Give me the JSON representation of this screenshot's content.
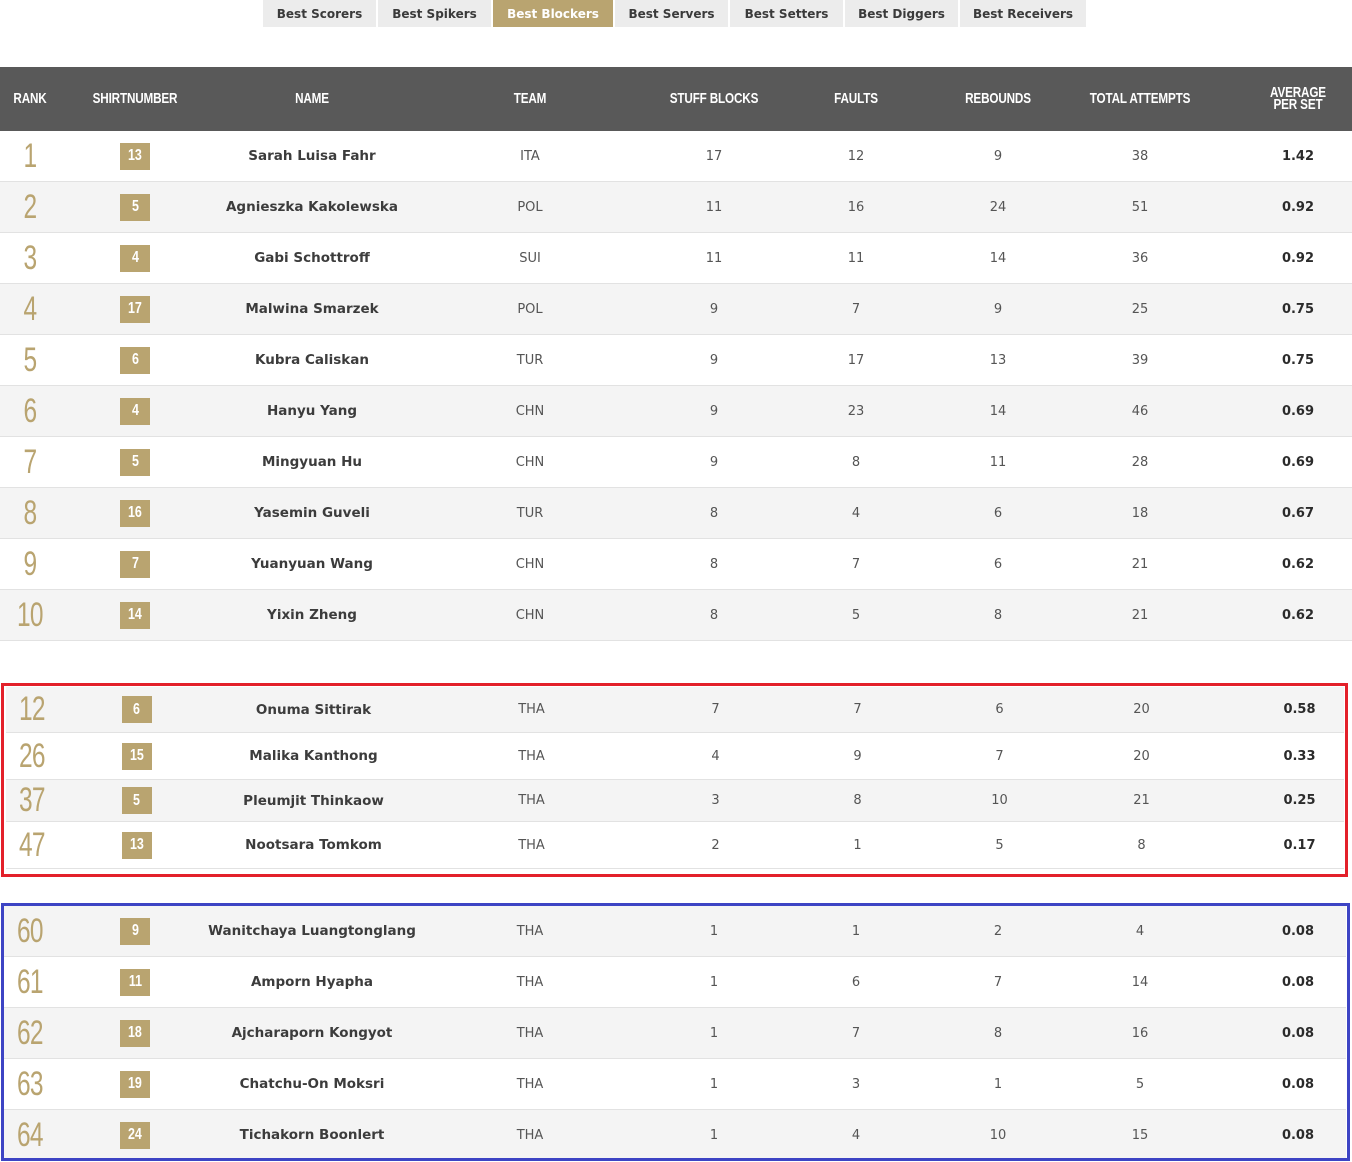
{
  "tabs": [
    {
      "label": "Best Scorers",
      "active": false
    },
    {
      "label": "Best Spikers",
      "active": false
    },
    {
      "label": "Best Blockers",
      "active": true
    },
    {
      "label": "Best Servers",
      "active": false
    },
    {
      "label": "Best Setters",
      "active": false
    },
    {
      "label": "Best Diggers",
      "active": false
    },
    {
      "label": "Best Receivers",
      "active": false
    }
  ],
  "table": {
    "headers": {
      "rank": "RANK",
      "shirtnumber": "SHIRTNUMBER",
      "name": "NAME",
      "team": "TEAM",
      "stuff_blocks": "STUFF BLOCKS",
      "faults": "FAULTS",
      "rebounds": "REBOUNDS",
      "total_attempts": "TOTAL ATTEMPTS",
      "average_per_set": "AVERAGE PER SET"
    },
    "top_rows": [
      {
        "rank": "1",
        "shirt": "13",
        "name": "Sarah Luisa Fahr",
        "team": "ITA",
        "stuff_blocks": "17",
        "faults": "12",
        "rebounds": "9",
        "total_attempts": "38",
        "avg": "1.42"
      },
      {
        "rank": "2",
        "shirt": "5",
        "name": "Agnieszka Kakolewska",
        "team": "POL",
        "stuff_blocks": "11",
        "faults": "16",
        "rebounds": "24",
        "total_attempts": "51",
        "avg": "0.92"
      },
      {
        "rank": "3",
        "shirt": "4",
        "name": "Gabi Schottroff",
        "team": "SUI",
        "stuff_blocks": "11",
        "faults": "11",
        "rebounds": "14",
        "total_attempts": "36",
        "avg": "0.92"
      },
      {
        "rank": "4",
        "shirt": "17",
        "name": "Malwina Smarzek",
        "team": "POL",
        "stuff_blocks": "9",
        "faults": "7",
        "rebounds": "9",
        "total_attempts": "25",
        "avg": "0.75"
      },
      {
        "rank": "5",
        "shirt": "6",
        "name": "Kubra Caliskan",
        "team": "TUR",
        "stuff_blocks": "9",
        "faults": "17",
        "rebounds": "13",
        "total_attempts": "39",
        "avg": "0.75"
      },
      {
        "rank": "6",
        "shirt": "4",
        "name": "Hanyu Yang",
        "team": "CHN",
        "stuff_blocks": "9",
        "faults": "23",
        "rebounds": "14",
        "total_attempts": "46",
        "avg": "0.69"
      },
      {
        "rank": "7",
        "shirt": "5",
        "name": "Mingyuan Hu",
        "team": "CHN",
        "stuff_blocks": "9",
        "faults": "8",
        "rebounds": "11",
        "total_attempts": "28",
        "avg": "0.69"
      },
      {
        "rank": "8",
        "shirt": "16",
        "name": "Yasemin Guveli",
        "team": "TUR",
        "stuff_blocks": "8",
        "faults": "4",
        "rebounds": "6",
        "total_attempts": "18",
        "avg": "0.67"
      },
      {
        "rank": "9",
        "shirt": "7",
        "name": "Yuanyuan Wang",
        "team": "CHN",
        "stuff_blocks": "8",
        "faults": "7",
        "rebounds": "6",
        "total_attempts": "21",
        "avg": "0.62"
      },
      {
        "rank": "10",
        "shirt": "14",
        "name": "Yixin Zheng",
        "team": "CHN",
        "stuff_blocks": "8",
        "faults": "5",
        "rebounds": "8",
        "total_attempts": "21",
        "avg": "0.62"
      }
    ],
    "red_rows": [
      {
        "rank": "12",
        "shirt": "6",
        "name": "Onuma Sittirak",
        "team": "THA",
        "stuff_blocks": "7",
        "faults": "7",
        "rebounds": "6",
        "total_attempts": "20",
        "avg": "0.58"
      },
      {
        "rank": "26",
        "shirt": "15",
        "name": "Malika Kanthong",
        "team": "THA",
        "stuff_blocks": "4",
        "faults": "9",
        "rebounds": "7",
        "total_attempts": "20",
        "avg": "0.33"
      },
      {
        "rank": "37",
        "shirt": "5",
        "name": "Pleumjit Thinkaow",
        "team": "THA",
        "stuff_blocks": "3",
        "faults": "8",
        "rebounds": "10",
        "total_attempts": "21",
        "avg": "0.25"
      },
      {
        "rank": "47",
        "shirt": "13",
        "name": "Nootsara Tomkom",
        "team": "THA",
        "stuff_blocks": "2",
        "faults": "1",
        "rebounds": "5",
        "total_attempts": "8",
        "avg": "0.17"
      }
    ],
    "blue_rows": [
      {
        "rank": "60",
        "shirt": "9",
        "name": "Wanitchaya Luangtonglang",
        "team": "THA",
        "stuff_blocks": "1",
        "faults": "1",
        "rebounds": "2",
        "total_attempts": "4",
        "avg": "0.08"
      },
      {
        "rank": "61",
        "shirt": "11",
        "name": "Amporn Hyapha",
        "team": "THA",
        "stuff_blocks": "1",
        "faults": "6",
        "rebounds": "7",
        "total_attempts": "14",
        "avg": "0.08"
      },
      {
        "rank": "62",
        "shirt": "18",
        "name": "Ajcharaporn Kongyot",
        "team": "THA",
        "stuff_blocks": "1",
        "faults": "7",
        "rebounds": "8",
        "total_attempts": "16",
        "avg": "0.08"
      },
      {
        "rank": "63",
        "shirt": "19",
        "name": "Chatchu-On Moksri",
        "team": "THA",
        "stuff_blocks": "1",
        "faults": "3",
        "rebounds": "1",
        "total_attempts": "5",
        "avg": "0.08"
      },
      {
        "rank": "64",
        "shirt": "24",
        "name": "Tichakorn Boonlert",
        "team": "THA",
        "stuff_blocks": "1",
        "faults": "4",
        "rebounds": "10",
        "total_attempts": "15",
        "avg": "0.08"
      }
    ]
  },
  "colors": {
    "accent_gold": "#b9a470",
    "header_bg": "#595959",
    "highlight_red": "#e3202a",
    "highlight_blue": "#3d44c4"
  }
}
